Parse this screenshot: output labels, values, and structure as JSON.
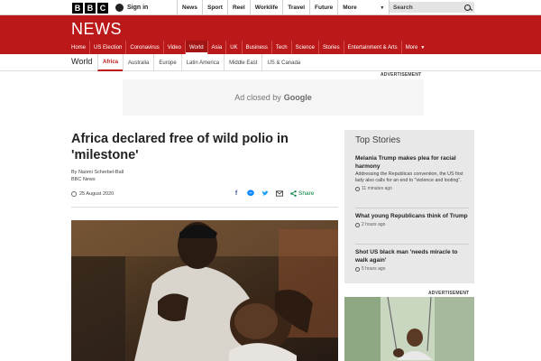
{
  "masthead": {
    "brand_letters": [
      "B",
      "B",
      "C"
    ],
    "signin_label": "Sign in",
    "nav": [
      "News",
      "Sport",
      "Reel",
      "Worklife",
      "Travel",
      "Future",
      "More"
    ],
    "search_placeholder": "Search"
  },
  "news_banner": {
    "logo": "NEWS",
    "nav": [
      "Home",
      "US Election",
      "Coronavirus",
      "Video",
      "World",
      "Asia",
      "UK",
      "Business",
      "Tech",
      "Science",
      "Stories",
      "Entertainment & Arts",
      "More"
    ],
    "active": "World"
  },
  "section_nav": {
    "section": "World",
    "links": [
      "Africa",
      "Australia",
      "Europe",
      "Latin America",
      "Middle East",
      "US & Canada"
    ],
    "active": "Africa"
  },
  "top_ad": {
    "label": "ADVERTISEMENT",
    "text": "Ad closed by",
    "brand": "Google"
  },
  "article": {
    "headline": "Africa declared free of wild polio in 'milestone'",
    "author": "By Naomi Scherbel-Ball",
    "outlet": "BBC News",
    "date": "25 August 2020",
    "share_label": "Share"
  },
  "top_stories": {
    "title": "Top Stories",
    "items": [
      {
        "headline": "Melania Trump makes plea for racial harmony",
        "summary": "Addressing the Republican convention, the US first lady also calls for an end to \"violence and looting\".",
        "time": "11 minutes ago"
      },
      {
        "headline": "What young Republicans think of Trump",
        "summary": "",
        "time": "2 hours ago"
      },
      {
        "headline": "Shot US black man 'needs miracle to walk again'",
        "summary": "",
        "time": "5 hours ago"
      }
    ]
  },
  "side_ad": {
    "label": "ADVERTISEMENT"
  },
  "colors": {
    "brand_red": "#bb1919",
    "share_green": "#007f3d",
    "facebook_blue": "#3b5998",
    "messenger_blue": "#0084ff",
    "twitter_blue": "#1da1f2"
  }
}
